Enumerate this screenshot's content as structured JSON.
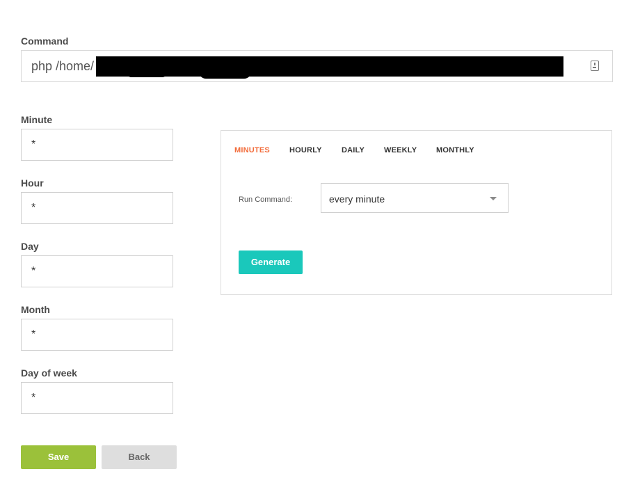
{
  "command": {
    "label": "Command",
    "value": "php /home/"
  },
  "fields": [
    {
      "label": "Minute",
      "value": "*"
    },
    {
      "label": "Hour",
      "value": "*"
    },
    {
      "label": "Day",
      "value": "*"
    },
    {
      "label": "Month",
      "value": "*"
    },
    {
      "label": "Day of week",
      "value": "*"
    }
  ],
  "generator": {
    "tabs": [
      {
        "label": "MINUTES",
        "active": true
      },
      {
        "label": "HOURLY",
        "active": false
      },
      {
        "label": "DAILY",
        "active": false
      },
      {
        "label": "WEEKLY",
        "active": false
      },
      {
        "label": "MONTHLY",
        "active": false
      }
    ],
    "run_label": "Run Command:",
    "run_value": "every minute",
    "generate_label": "Generate"
  },
  "actions": {
    "save_label": "Save",
    "back_label": "Back"
  },
  "colors": {
    "accent_tab": "#f26b3a",
    "generate": "#1ac8bb",
    "save": "#9bc13a",
    "back": "#dedede"
  },
  "icons": {
    "command_field": "clipboard-icon",
    "select": "chevron-down-icon"
  }
}
